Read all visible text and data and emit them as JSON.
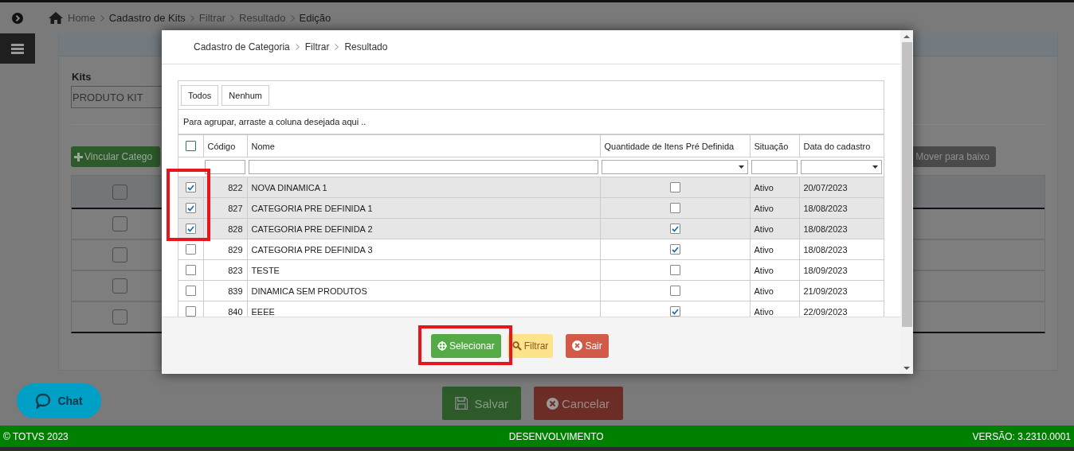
{
  "breadcrumb": [
    "Home",
    "Cadastro de Kits",
    "Filtrar",
    "Resultado",
    "Edição"
  ],
  "kits": {
    "label": "Kits",
    "value": "PRODUTO KIT"
  },
  "link_button": "Vincular Catego",
  "move_down_button": "Mover para baixo",
  "background_rows": [
    {
      "checked": false
    },
    {
      "checked": false
    },
    {
      "checked": false
    },
    {
      "checked": false
    }
  ],
  "background_header_checked": false,
  "save_button": "Salvar",
  "cancel_button": "Cancelar",
  "chat_button": "Chat",
  "footer": {
    "copyright": "© TOTVS 2023",
    "environment": "DESENVOLVIMENTO",
    "version": "VERSÃO: 3.2310.0001"
  },
  "modal": {
    "breadcrumb": [
      "Cadastro de Categoria",
      "Filtrar",
      "Resultado"
    ],
    "all_button": "Todos",
    "none_button": "Nenhum",
    "group_hint": "Para agrupar, arraste a coluna desejada aqui ..",
    "select_all_checked": false,
    "columns": [
      "Código",
      "Nome",
      "Quantidade de Itens Pré Definida",
      "Situação",
      "Data do cadastro"
    ],
    "rows": [
      {
        "selected": true,
        "code": "822",
        "name": "NOVA DINAMICA 1",
        "predefined": false,
        "status": "Ativo",
        "date": "20/07/2023"
      },
      {
        "selected": true,
        "code": "827",
        "name": "CATEGORIA PRE DEFINIDA 1",
        "predefined": false,
        "status": "Ativo",
        "date": "18/08/2023"
      },
      {
        "selected": true,
        "code": "828",
        "name": "CATEGORIA PRE DEFINIDA 2",
        "predefined": true,
        "status": "Ativo",
        "date": "18/08/2023"
      },
      {
        "selected": false,
        "code": "829",
        "name": "CATEGORIA PRE DEFINIDA 3",
        "predefined": true,
        "status": "Ativo",
        "date": "18/08/2023"
      },
      {
        "selected": false,
        "code": "823",
        "name": "TESTE",
        "predefined": false,
        "status": "Ativo",
        "date": "18/09/2023"
      },
      {
        "selected": false,
        "code": "839",
        "name": "DINAMICA SEM PRODUTOS",
        "predefined": false,
        "status": "Ativo",
        "date": "21/09/2023"
      },
      {
        "selected": false,
        "code": "840",
        "name": "EEEE",
        "predefined": true,
        "status": "Ativo",
        "date": "22/09/2023"
      }
    ],
    "buttons": [
      {
        "kind": "select",
        "label": "Selecionar"
      },
      {
        "kind": "filter",
        "label": "Filtrar"
      },
      {
        "kind": "exit",
        "label": "Sair"
      }
    ]
  }
}
